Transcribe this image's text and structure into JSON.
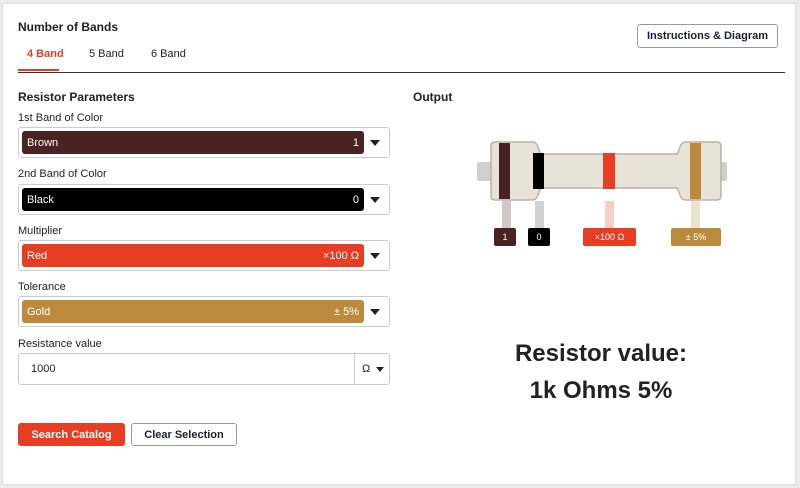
{
  "bands": {
    "title": "Number of Bands",
    "tabs": [
      {
        "label": "4 Band",
        "active": true
      },
      {
        "label": "5 Band",
        "active": false
      },
      {
        "label": "6 Band",
        "active": false
      }
    ]
  },
  "instructions_button": "Instructions & Diagram",
  "params": {
    "title": "Resistor Parameters",
    "band1": {
      "label": "1st Band of Color",
      "color_name": "Brown",
      "value": "1",
      "color": "#4a2222"
    },
    "band2": {
      "label": "2nd Band of Color",
      "color_name": "Black",
      "value": "0",
      "color": "#000000"
    },
    "multiplier": {
      "label": "Multiplier",
      "color_name": "Red",
      "value": "×100 Ω",
      "color": "#e63d23"
    },
    "tolerance": {
      "label": "Tolerance",
      "color_name": "Gold",
      "value": "± 5%",
      "color": "#bb8a3c"
    }
  },
  "resistance": {
    "label": "Resistance value",
    "value": "1000",
    "unit": "Ω"
  },
  "buttons": {
    "search": "Search Catalog",
    "clear": "Clear Selection"
  },
  "output": {
    "title": "Output",
    "labels": [
      "1",
      "0",
      "×100 Ω",
      "± 5%"
    ],
    "result_line1": "Resistor value:",
    "result_line2": "1k Ohms 5%"
  },
  "colors": {
    "accent": "#e63d23",
    "resistor_body": "#e9e2d9"
  }
}
